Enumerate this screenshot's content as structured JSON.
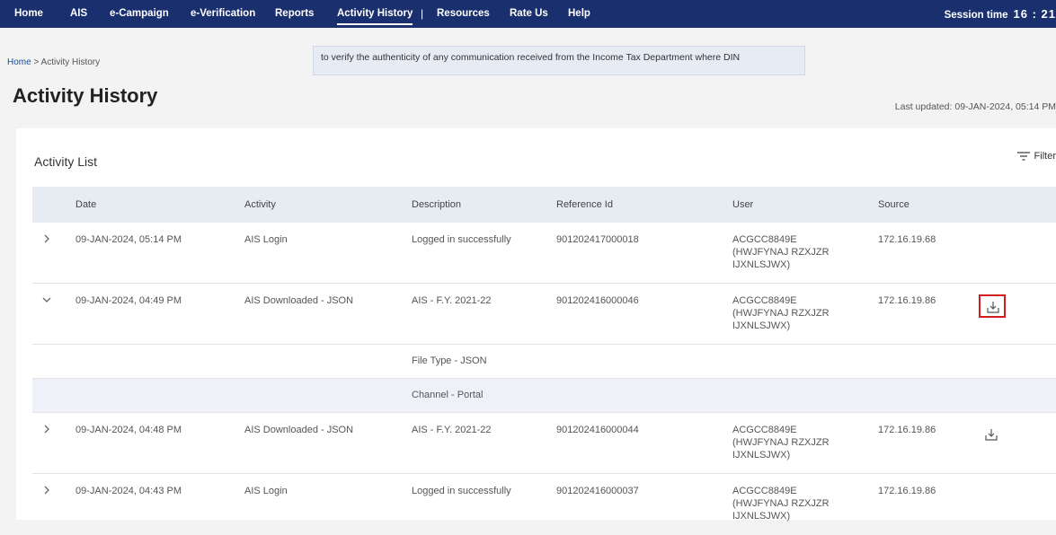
{
  "nav": {
    "items": [
      {
        "label": "Home"
      },
      {
        "label": "AIS"
      },
      {
        "label": "e-Campaign"
      },
      {
        "label": "e-Verification"
      },
      {
        "label": "Reports"
      },
      {
        "label": "Activity History"
      },
      {
        "label": "Resources"
      },
      {
        "label": "Rate Us"
      },
      {
        "label": "Help"
      }
    ],
    "separator": "|",
    "session_label": "Session time",
    "session_time": "16 : 21"
  },
  "breadcrumb": {
    "home": "Home",
    "separator": ">",
    "current": "Activity History"
  },
  "banner": {
    "text": "to verify the authenticity of any communication received from the Income Tax Department where DIN"
  },
  "page": {
    "title": "Activity History",
    "last_updated": "Last updated: 09-JAN-2024, 05:14 PM"
  },
  "list": {
    "title": "Activity List",
    "filter_label": "Filter"
  },
  "table": {
    "headers": [
      "Date",
      "Activity",
      "Description",
      "Reference Id",
      "User",
      "Source"
    ],
    "rows": [
      {
        "date": "09-JAN-2024, 05:14 PM",
        "activity": "AIS Login",
        "description": "Logged in successfully",
        "reference_id": "901202417000018",
        "user_line1": "ACGCC8849E",
        "user_line2": "(HWJFYNAJ RZXJZR",
        "user_line3": "IJXNLSJWX)",
        "source": "172.16.19.68",
        "expanded": false,
        "download": false
      },
      {
        "date": "09-JAN-2024, 04:49 PM",
        "activity": "AIS Downloaded - JSON",
        "description": "AIS - F.Y. 2021-22",
        "reference_id": "901202416000046",
        "user_line1": "ACGCC8849E",
        "user_line2": "(HWJFYNAJ RZXJZR",
        "user_line3": "IJXNLSJWX)",
        "source": "172.16.19.86",
        "expanded": true,
        "download": true,
        "details": [
          "File Type - JSON",
          "Channel - Portal"
        ]
      },
      {
        "date": "09-JAN-2024, 04:48 PM",
        "activity": "AIS Downloaded - JSON",
        "description": "AIS - F.Y. 2021-22",
        "reference_id": "901202416000044",
        "user_line1": "ACGCC8849E",
        "user_line2": "(HWJFYNAJ RZXJZR",
        "user_line3": "IJXNLSJWX)",
        "source": "172.16.19.86",
        "expanded": false,
        "download": true
      },
      {
        "date": "09-JAN-2024, 04:43 PM",
        "activity": "AIS Login",
        "description": "Logged in successfully",
        "reference_id": "901202416000037",
        "user_line1": "ACGCC8849E",
        "user_line2": "(HWJFYNAJ RZXJZR",
        "user_line3": "IJXNLSJWX)",
        "source": "172.16.19.86",
        "expanded": false,
        "download": false
      }
    ]
  }
}
